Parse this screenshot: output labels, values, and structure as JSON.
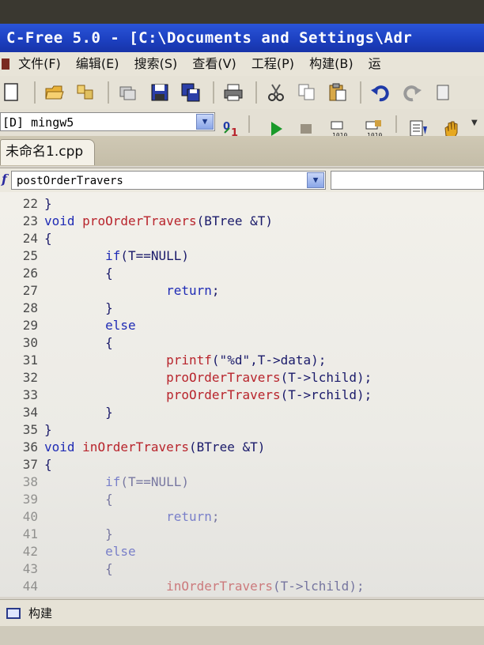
{
  "window": {
    "title": "C-Free 5.0 - [C:\\Documents and Settings\\Adr"
  },
  "menu": [
    {
      "label": "文件(F)"
    },
    {
      "label": "编辑(E)"
    },
    {
      "label": "搜索(S)"
    },
    {
      "label": "查看(V)"
    },
    {
      "label": "工程(P)"
    },
    {
      "label": "构建(B)"
    },
    {
      "label": "运"
    }
  ],
  "compiler": {
    "selected": "[D] mingw5"
  },
  "tabs": [
    {
      "label": "未命名1.cpp"
    }
  ],
  "function_selector": {
    "selected": "postOrderTravers"
  },
  "code_lines": [
    {
      "num": "22",
      "text": "}"
    },
    {
      "num": "23",
      "text": "void proOrderTravers(BTree &T)"
    },
    {
      "num": "24",
      "text": "{"
    },
    {
      "num": "25",
      "text": "        if(T==NULL)"
    },
    {
      "num": "26",
      "text": "        {"
    },
    {
      "num": "27",
      "text": "                return;"
    },
    {
      "num": "28",
      "text": "        }"
    },
    {
      "num": "29",
      "text": "        else"
    },
    {
      "num": "30",
      "text": "        {"
    },
    {
      "num": "31",
      "text": "                printf(\"%d\",T->data);"
    },
    {
      "num": "32",
      "text": "                proOrderTravers(T->lchild);"
    },
    {
      "num": "33",
      "text": "                proOrderTravers(T->rchild);"
    },
    {
      "num": "34",
      "text": "        }"
    },
    {
      "num": "35",
      "text": "}"
    },
    {
      "num": "36",
      "text": "void inOrderTravers(BTree &T)"
    },
    {
      "num": "37",
      "text": "{"
    },
    {
      "num": "38",
      "text": "        if(T==NULL)"
    },
    {
      "num": "39",
      "text": "        {"
    },
    {
      "num": "40",
      "text": "                return;"
    },
    {
      "num": "41",
      "text": "        }"
    },
    {
      "num": "42",
      "text": "        else"
    },
    {
      "num": "43",
      "text": "        {"
    },
    {
      "num": "44",
      "text": "                inOrderTravers(T->lchild);"
    }
  ],
  "status": {
    "label": "构建"
  },
  "colors": {
    "titlebar": "#1c3fbf",
    "keyword": "#1f2bb5",
    "function": "#b8242c"
  },
  "icons": [
    "new-file-icon",
    "open-folder-icon",
    "save-icon",
    "save-all-icon",
    "print-icon",
    "cut-icon",
    "copy-icon",
    "paste-icon",
    "undo-icon",
    "redo-icon",
    "compile-icon",
    "run-icon",
    "stop-icon",
    "build-icon",
    "rebuild-icon",
    "list-icon",
    "hand-icon"
  ]
}
